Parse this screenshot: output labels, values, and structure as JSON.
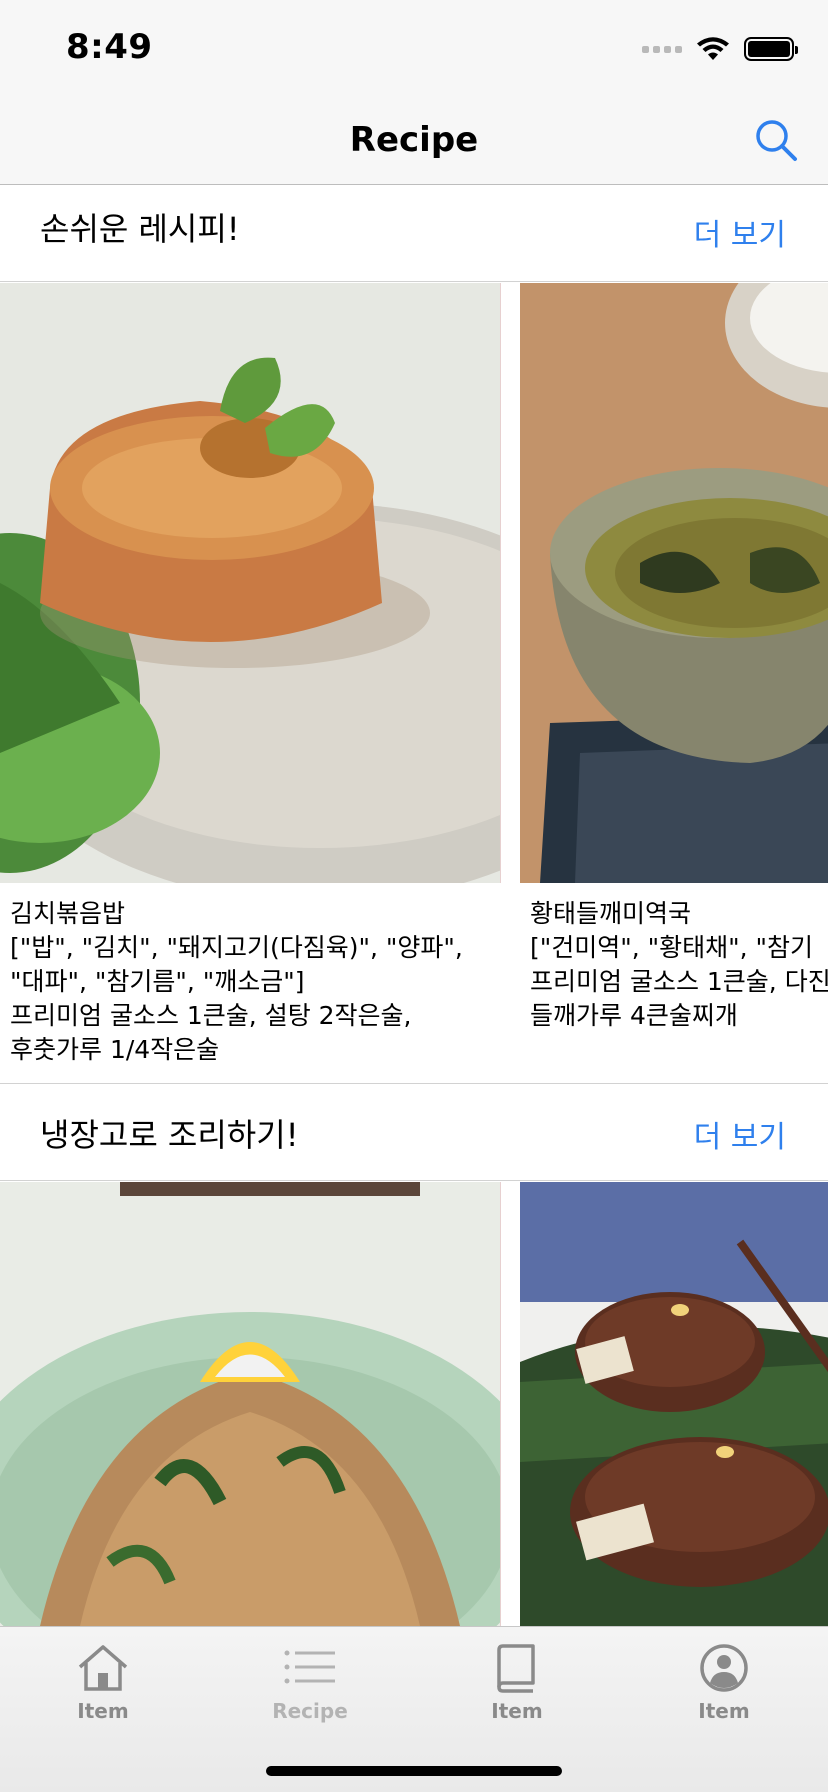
{
  "status": {
    "time": "8:49"
  },
  "nav": {
    "title": "Recipe",
    "search_icon": "magnifier-icon"
  },
  "sections": [
    {
      "title": "손쉬운 레시피!",
      "more": "더 보기",
      "cards": [
        {
          "image": "kimchi-fried-rice-photo",
          "title": "김치볶음밥",
          "ingredients": "[\"밥\", \"김치\", \"돼지고기(다짐육)\", \"양파\", \"대파\", \"참기름\", \"깨소금\"]",
          "seasoning": "프리미엄 굴소스 1큰술, 설탕 2작은술, 후춧가루 1/4작은술"
        },
        {
          "image": "dried-pollack-perilla-seaweed-soup-photo",
          "title": "황태들깨미역국",
          "ingredients": "[\"건미역\", \"황태채\", \"참기",
          "seasoning": "프리미엄 굴소스 1큰술, 다진",
          "seasoning2": "들깨가루 4큰술찌개"
        }
      ]
    },
    {
      "title": "냉장고로 조리하기!",
      "more": "더 보기",
      "cards": [
        {
          "image": "japchae-glass-noodles-photo"
        },
        {
          "image": "tteokgalbi-meat-rolls-photo"
        }
      ]
    }
  ],
  "tabs": [
    {
      "label": "Item",
      "icon": "home-icon"
    },
    {
      "label": "Recipe",
      "icon": "list-icon"
    },
    {
      "label": "Item",
      "icon": "book-icon"
    },
    {
      "label": "Item",
      "icon": "person-icon"
    }
  ],
  "colors": {
    "accent": "#2f80ed",
    "tab_active": "#8a8a8a",
    "tab_inactive": "#b3b3b3"
  }
}
